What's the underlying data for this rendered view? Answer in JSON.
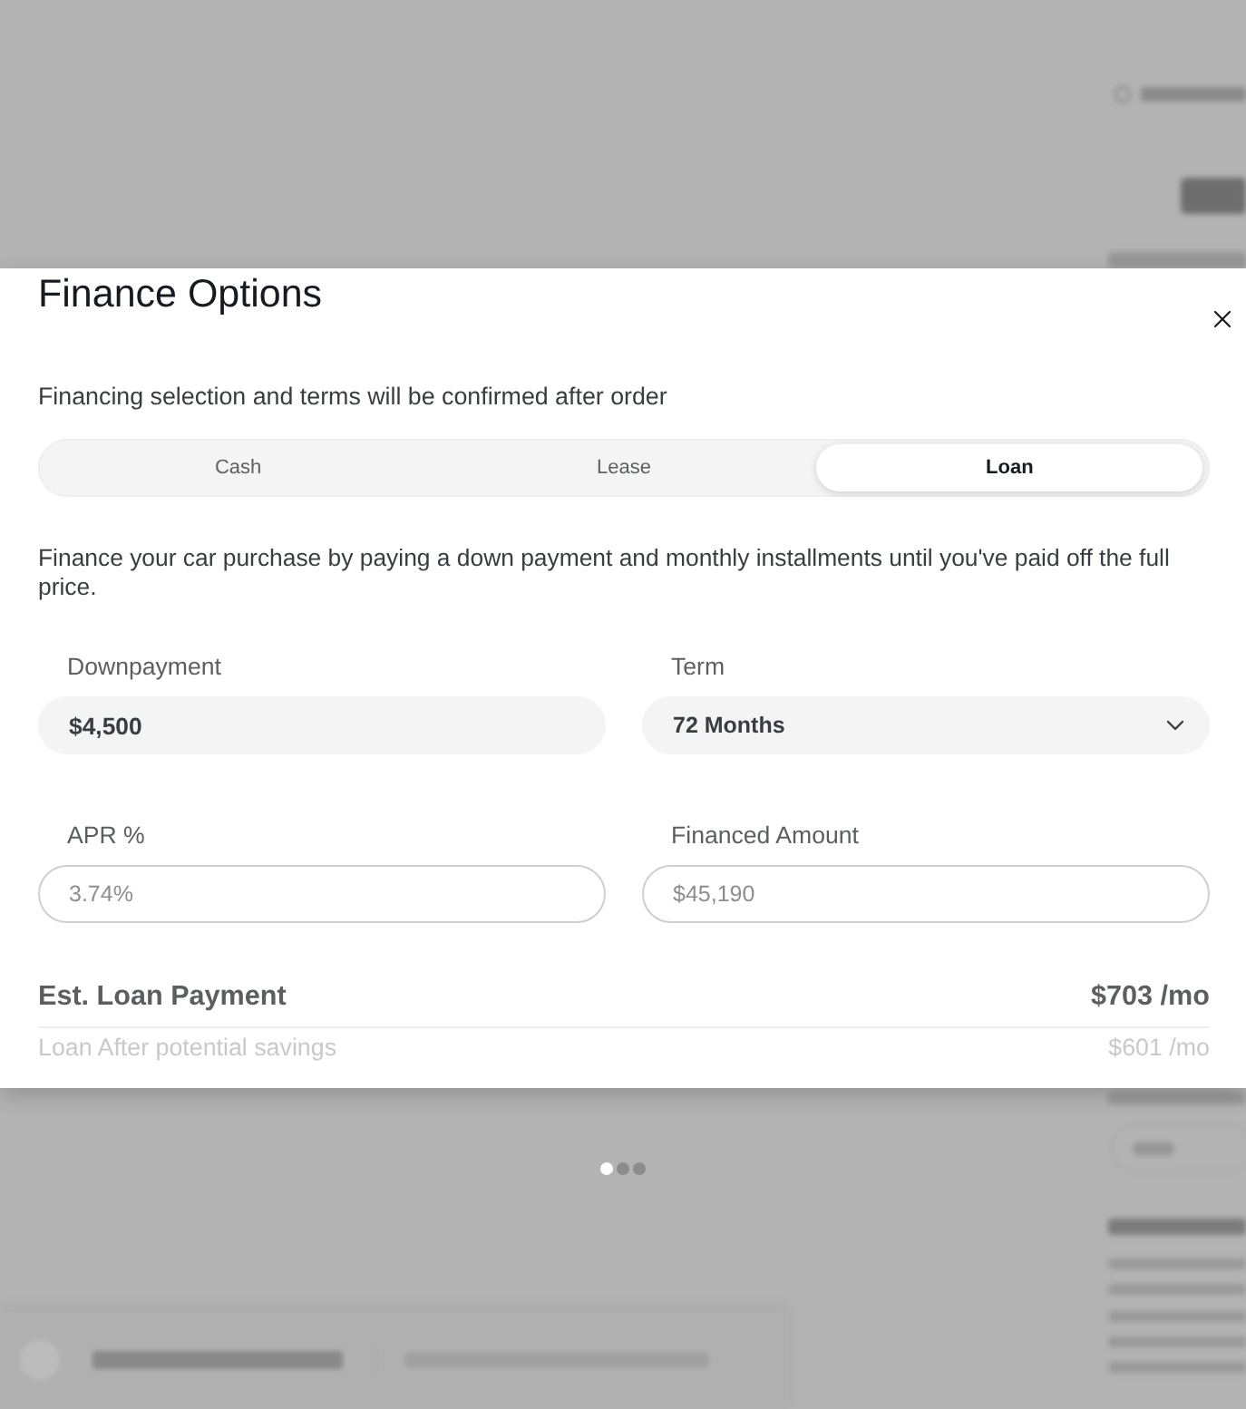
{
  "modal": {
    "title": "Finance Options",
    "notice": "Financing selection and terms will be confirmed after order",
    "tabs": [
      {
        "label": "Cash",
        "selected": false
      },
      {
        "label": "Lease",
        "selected": false
      },
      {
        "label": "Loan",
        "selected": true
      }
    ],
    "description": "Finance your car purchase by paying a down payment and monthly installments until you've paid off the full price.",
    "fields": [
      {
        "kind": "input",
        "label": "Downpayment",
        "value": "$4,500",
        "disabled": false
      },
      {
        "kind": "select",
        "label": "Term",
        "value": "72 Months",
        "disabled": false
      },
      {
        "kind": "input",
        "label": "APR %",
        "value": "3.74%",
        "disabled": true
      },
      {
        "kind": "input",
        "label": "Financed Amount",
        "value": "$45,190",
        "disabled": true
      }
    ],
    "summary": [
      {
        "kind": "total",
        "label": "Est. Loan Payment",
        "value": "$703 /mo"
      },
      {
        "kind": "savings",
        "label": "Loan After potential savings",
        "value": "$601 /mo"
      }
    ]
  },
  "carousel_dots": [
    {
      "selected": true
    },
    {
      "selected": false
    },
    {
      "selected": false
    }
  ]
}
